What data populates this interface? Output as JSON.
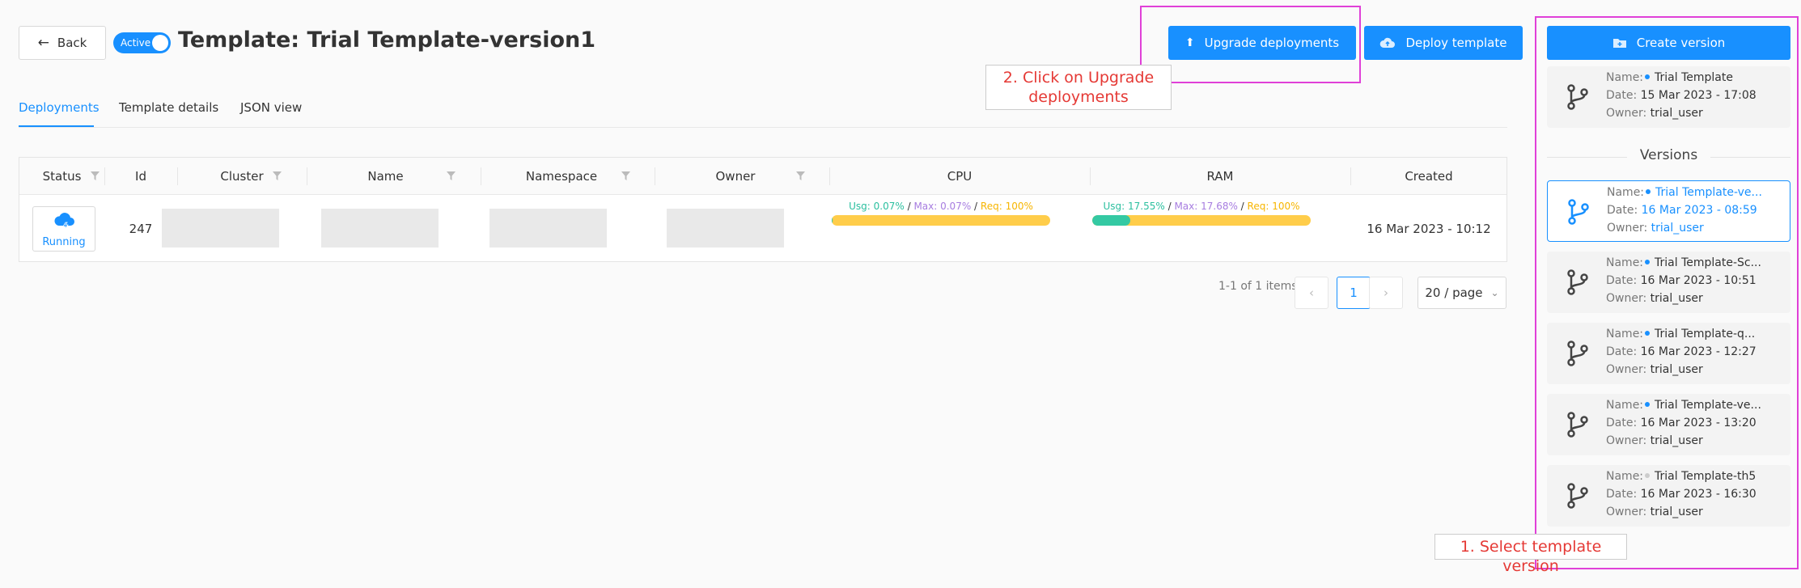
{
  "header": {
    "back_label": "Back",
    "status_label": "Active",
    "title": "Template: Trial Template-version1",
    "upgrade_label": "Upgrade deployments",
    "deploy_label": "Deploy template",
    "create_version_label": "Create version"
  },
  "tabs": [
    {
      "label": "Deployments",
      "active": true
    },
    {
      "label": "Template details",
      "active": false
    },
    {
      "label": "JSON view",
      "active": false
    }
  ],
  "table": {
    "columns": [
      "Status",
      "Id",
      "Cluster",
      "Name",
      "Namespace",
      "Owner",
      "CPU",
      "RAM",
      "Created"
    ],
    "rows": [
      {
        "status": "Running",
        "id": "247",
        "cpu": {
          "usg": "Usg: 0.07%",
          "max": "Max: 0.07%",
          "req": "Req: 100%",
          "fill_fraction": 0.0007
        },
        "ram": {
          "usg": "Usg: 17.55%",
          "max": "Max: 17.68%",
          "req": "Req: 100%",
          "fill_fraction": 0.1755
        },
        "created": "16 Mar 2023 - 10:12"
      }
    ]
  },
  "pagination": {
    "summary": "1-1 of 1 items",
    "current_page": "1",
    "page_size": "20 / page"
  },
  "sidebar": {
    "current": {
      "name_key": "Name:",
      "name": "Trial Template",
      "date_key": "Date:",
      "date": "15 Mar 2023 - 17:08",
      "owner_key": "Owner:",
      "owner": "trial_user"
    },
    "versions_heading": "Versions",
    "versions": [
      {
        "name": "Trial Template-ve...",
        "date": "16 Mar 2023 - 08:59",
        "owner": "trial_user",
        "selected": true,
        "dot": "blue"
      },
      {
        "name": "Trial Template-Sc...",
        "date": "16 Mar 2023 - 10:51",
        "owner": "trial_user",
        "selected": false,
        "dot": "blue"
      },
      {
        "name": "Trial Template-q...",
        "date": "16 Mar 2023 - 12:27",
        "owner": "trial_user",
        "selected": false,
        "dot": "blue"
      },
      {
        "name": "Trial Template-ve...",
        "date": "16 Mar 2023 - 13:20",
        "owner": "trial_user",
        "selected": false,
        "dot": "blue"
      },
      {
        "name": "Trial Template-th5",
        "date": "16 Mar 2023 - 16:30",
        "owner": "trial_user",
        "selected": false,
        "dot": "grey"
      }
    ],
    "labels": {
      "name": "Name:",
      "date": "Date:",
      "owner": "Owner:"
    }
  },
  "annotations": {
    "step1": "1. Select template version",
    "step2_line1": "2. Click on Upgrade",
    "step2_line2": "deployments"
  },
  "colors": {
    "accent": "#1890ff",
    "annotation_border": "#e040d8",
    "annotation_text": "#e53935",
    "usage_green": "#2bbf9f",
    "usage_purple": "#a77de0",
    "usage_yellow": "#f7b500"
  }
}
